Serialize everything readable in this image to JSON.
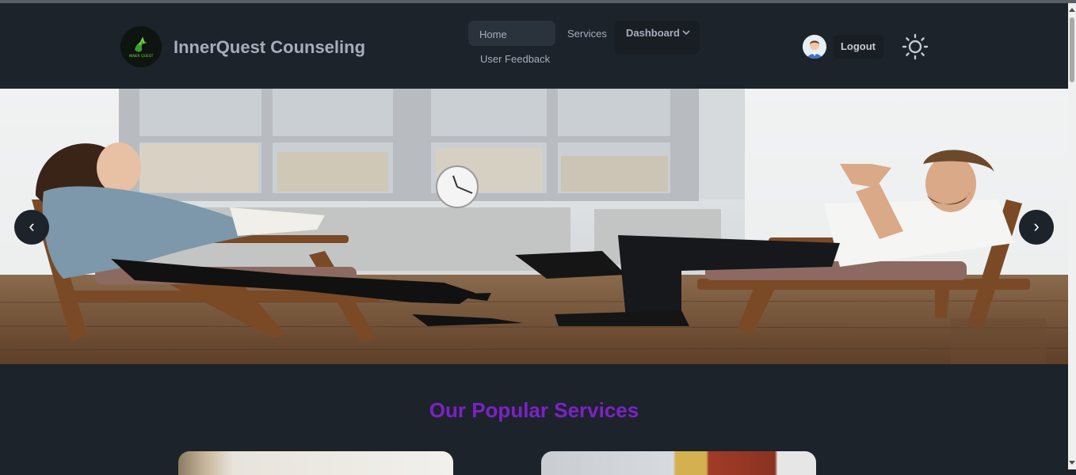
{
  "brand": {
    "name": "InnerQuest Counseling",
    "logo_text": "INNER QUEST"
  },
  "nav": {
    "home": "Home",
    "services": "Services",
    "dashboard": "Dashboard",
    "feedback": "User Feedback"
  },
  "user": {
    "logout": "Logout"
  },
  "carousel": {
    "prev": "‹",
    "next": "›"
  },
  "main": {
    "section_title": "Our Popular Services"
  },
  "colors": {
    "background": "#1d232a",
    "accent_purple": "#7b22c7",
    "button_dark": "#191e24"
  },
  "icons": [
    "chevron-down-icon",
    "sun-icon",
    "user-avatar-icon"
  ]
}
